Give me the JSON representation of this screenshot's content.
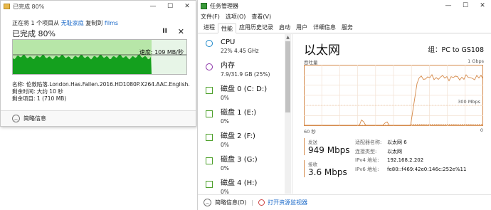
{
  "copy_dialog": {
    "title": "已完成 80%",
    "controls": {
      "minimize": "—",
      "maximize": "☐",
      "close": "✕"
    },
    "status_prefix": "正在将 1 个项目从",
    "source_link": "无耻家庭",
    "status_middle": "复制到",
    "dest_link": "films",
    "percent_text": "已完成 80%",
    "progress_fraction": 0.8,
    "pause_glyph": "II",
    "cancel_glyph": "✕",
    "speed_text": "速度: 109 MB/秒",
    "name_line": "名称: 伦敦陷落.London.Has.Fallen.2016.HD1080P.X264.AAC.English...",
    "time_line": "剩余时间: 大约 10 秒",
    "items_line": "剩余项目: 1 (710 MB)",
    "brief_info": "简略信息"
  },
  "task_manager": {
    "title": "任务管理器",
    "controls": {
      "minimize": "—",
      "maximize": "☐",
      "close": "✕"
    },
    "menu": [
      "文件(F)",
      "选项(O)",
      "查看(V)"
    ],
    "tabs": [
      "进程",
      "性能",
      "应用历史记录",
      "启动",
      "用户",
      "详细信息",
      "服务"
    ],
    "active_tab": 1,
    "side_items": [
      {
        "name": "CPU",
        "sub": "22%  4.45 GHz",
        "color": "#1b87c9",
        "shape": "ring"
      },
      {
        "name": "内存",
        "sub": "7.9/31.9 GB (25%)",
        "color": "#8b32a8",
        "shape": "ring"
      },
      {
        "name": "磁盘 0 (C: D:)",
        "sub": "0%",
        "color": "#4da02a",
        "shape": "sq"
      },
      {
        "name": "磁盘 1 (E:)",
        "sub": "0%",
        "color": "#4da02a",
        "shape": "sq"
      },
      {
        "name": "磁盘 2 (F:)",
        "sub": "0%",
        "color": "#4da02a",
        "shape": "sq"
      },
      {
        "name": "磁盘 3 (G:)",
        "sub": "0%",
        "color": "#4da02a",
        "shape": "sq"
      },
      {
        "name": "磁盘 4 (H:)",
        "sub": "0%",
        "color": "#4da02a",
        "shape": "sq"
      }
    ],
    "detail": {
      "title": "以太网",
      "adapter": "组：PC to GS108",
      "y_label": "吞吐量",
      "y_max": "1 Gbps",
      "mid_label": "300 Mbps",
      "x_left": "60 秒",
      "x_right": "0",
      "send_label": "发送",
      "send_value": "949 Mbps",
      "recv_label": "接收",
      "recv_value": "3.6 Mbps",
      "properties": [
        {
          "k": "适配器名称:",
          "v": "以太网 6"
        },
        {
          "k": "连接类型:",
          "v": "以太网"
        },
        {
          "k": "IPv4 地址:",
          "v": "192.168.2.202"
        },
        {
          "k": "IPv6 地址:",
          "v": "fe80::f469:42e0:146c:252e%11"
        }
      ],
      "accent_color": "#d58a4a"
    },
    "footer": {
      "brief": "简略信息(D)",
      "monitor": "打开资源监视器"
    }
  }
}
